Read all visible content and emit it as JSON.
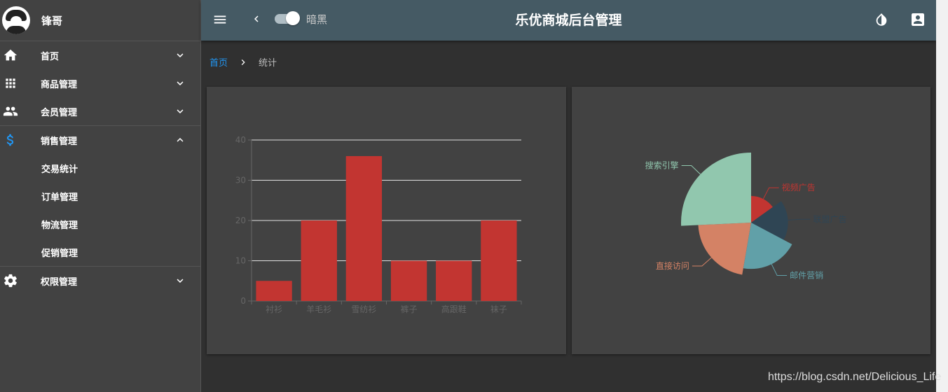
{
  "user": {
    "name": "锋哥"
  },
  "sidebar": {
    "items": [
      {
        "label": "首页",
        "icon": "home-icon"
      },
      {
        "label": "商品管理",
        "icon": "apps-icon"
      },
      {
        "label": "会员管理",
        "icon": "people-icon"
      },
      {
        "label": "销售管理",
        "icon": "dollar-icon",
        "expanded": true,
        "children": [
          "交易统计",
          "订单管理",
          "物流管理",
          "促销管理"
        ]
      },
      {
        "label": "权限管理",
        "icon": "gear-icon"
      }
    ]
  },
  "header": {
    "title": "乐优商城后台管理",
    "dark_toggle_label": "暗黑",
    "dark_mode": true,
    "color": "#455a64"
  },
  "breadcrumb": {
    "home": "首页",
    "current": "统计"
  },
  "chart_data": [
    {
      "type": "bar",
      "categories": [
        "衬衫",
        "羊毛衫",
        "雪纺衫",
        "裤子",
        "高跟鞋",
        "袜子"
      ],
      "values": [
        5,
        20,
        36,
        10,
        10,
        20
      ],
      "ylim": [
        0,
        40
      ],
      "yticks": [
        0,
        10,
        20,
        30,
        40
      ],
      "grid": true,
      "color": "#c23531"
    },
    {
      "type": "pie",
      "rose": true,
      "slices": [
        {
          "name": "视频广告",
          "value": 235,
          "color": "#c23531"
        },
        {
          "name": "联盟广告",
          "value": 274,
          "color": "#2f4554"
        },
        {
          "name": "邮件营销",
          "value": 310,
          "color": "#61a0a8"
        },
        {
          "name": "直接访问",
          "value": 335,
          "color": "#d48265"
        },
        {
          "name": "搜索引擎",
          "value": 400,
          "color": "#91c7ae"
        }
      ]
    }
  ],
  "watermark": "https://blog.csdn.net/Delicious_Life"
}
